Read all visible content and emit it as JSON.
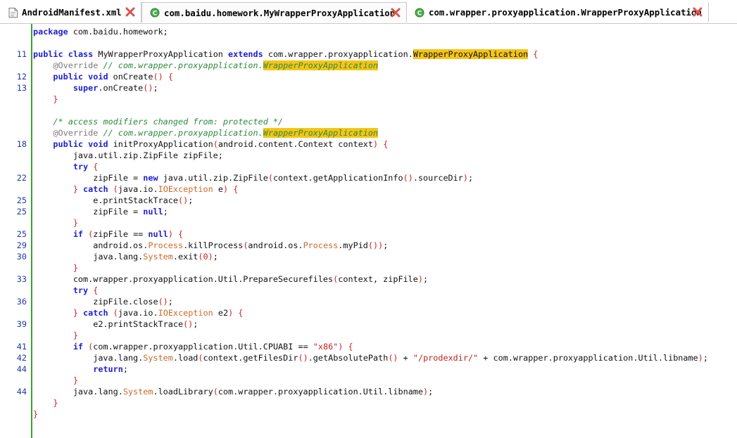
{
  "tabs": [
    {
      "label": "AndroidManifest.xml",
      "icon": "xml-file-icon",
      "active": false
    },
    {
      "label": "com.baidu.homework.MyWrapperProxyApplication",
      "icon": "java-class-icon",
      "active": true
    },
    {
      "label": "com.wrapper.proxyapplication.WrapperProxyApplication",
      "icon": "java-class-icon",
      "active": false
    }
  ],
  "colors": {
    "keyword": "#1f1fd0",
    "comment": "#2d8a3d",
    "annotation": "#7a7a7a",
    "highlight": "#f5c518",
    "class_ref": "#c86a2a",
    "bracket": "#d32020",
    "line_number": "#1d3a9e",
    "close_icon": "#d9534f"
  },
  "code_lines": [
    {
      "ln": "",
      "tokens": [
        [
          "kw",
          "package"
        ],
        [
          "p",
          " com.baidu.homework;"
        ]
      ]
    },
    {
      "ln": "",
      "tokens": []
    },
    {
      "ln": "11",
      "tokens": [
        [
          "kw",
          "public"
        ],
        [
          "p",
          " "
        ],
        [
          "kw",
          "class"
        ],
        [
          "p",
          " MyWrapperProxyApplication "
        ],
        [
          "kw",
          "extends"
        ],
        [
          "p",
          " com.wrapper.proxyapplication."
        ],
        [
          "hl",
          "WrapperProxyApplication"
        ],
        [
          "p",
          " "
        ],
        [
          "br",
          "{"
        ]
      ]
    },
    {
      "ln": "",
      "tokens": [
        [
          "p",
          "    "
        ],
        [
          "an",
          "@Override"
        ],
        [
          "cm",
          " // com.wrapper.proxyapplication."
        ],
        [
          "cmhl",
          "WrapperProxyApplication"
        ]
      ]
    },
    {
      "ln": "12",
      "tokens": [
        [
          "p",
          "    "
        ],
        [
          "kw",
          "public"
        ],
        [
          "p",
          " "
        ],
        [
          "kw",
          "void"
        ],
        [
          "p",
          " onCreate"
        ],
        [
          "br",
          "()"
        ],
        [
          "p",
          " "
        ],
        [
          "br",
          "{"
        ]
      ]
    },
    {
      "ln": "13",
      "tokens": [
        [
          "p",
          "        "
        ],
        [
          "kw",
          "super"
        ],
        [
          "p",
          ".onCreate"
        ],
        [
          "br",
          "()"
        ],
        [
          "p",
          ";"
        ]
      ]
    },
    {
      "ln": "",
      "tokens": [
        [
          "p",
          "    "
        ],
        [
          "br",
          "}"
        ]
      ]
    },
    {
      "ln": "",
      "tokens": []
    },
    {
      "ln": "",
      "tokens": [
        [
          "p",
          "    "
        ],
        [
          "cm",
          "/* access modifiers changed from: protected */"
        ]
      ]
    },
    {
      "ln": "",
      "tokens": [
        [
          "p",
          "    "
        ],
        [
          "an",
          "@Override"
        ],
        [
          "cm",
          " // com.wrapper.proxyapplication."
        ],
        [
          "cmhl",
          "WrapperProxyApplication"
        ]
      ]
    },
    {
      "ln": "18",
      "tokens": [
        [
          "p",
          "    "
        ],
        [
          "kw",
          "public"
        ],
        [
          "p",
          " "
        ],
        [
          "kw",
          "void"
        ],
        [
          "p",
          " initProxyApplication"
        ],
        [
          "br",
          "("
        ],
        [
          "p",
          "android.content.Context context"
        ],
        [
          "br",
          ")"
        ],
        [
          "p",
          " "
        ],
        [
          "br",
          "{"
        ]
      ]
    },
    {
      "ln": "",
      "tokens": [
        [
          "p",
          "        java.util.zip.ZipFile zipFile;"
        ]
      ]
    },
    {
      "ln": "",
      "tokens": [
        [
          "p",
          "        "
        ],
        [
          "kw",
          "try"
        ],
        [
          "p",
          " "
        ],
        [
          "br",
          "{"
        ]
      ]
    },
    {
      "ln": "22",
      "tokens": [
        [
          "p",
          "            zipFile = "
        ],
        [
          "kw",
          "new"
        ],
        [
          "p",
          " java.util.zip.ZipFile"
        ],
        [
          "br",
          "("
        ],
        [
          "p",
          "context.getApplicationInfo"
        ],
        [
          "br",
          "()"
        ],
        [
          "p",
          ".sourceDir"
        ],
        [
          "br",
          ")"
        ],
        [
          "p",
          ";"
        ]
      ]
    },
    {
      "ln": "",
      "tokens": [
        [
          "p",
          "        "
        ],
        [
          "br",
          "}"
        ],
        [
          "p",
          " "
        ],
        [
          "kw",
          "catch"
        ],
        [
          "p",
          " "
        ],
        [
          "br",
          "("
        ],
        [
          "p",
          "java.io."
        ],
        [
          "cls",
          "IOException"
        ],
        [
          "p",
          " e"
        ],
        [
          "br",
          ")"
        ],
        [
          "p",
          " "
        ],
        [
          "br",
          "{"
        ]
      ]
    },
    {
      "ln": "25",
      "tokens": [
        [
          "p",
          "            e.printStackTrace"
        ],
        [
          "br",
          "()"
        ],
        [
          "p",
          ";"
        ]
      ]
    },
    {
      "ln": "25",
      "tokens": [
        [
          "p",
          "            zipFile = "
        ],
        [
          "kw",
          "null"
        ],
        [
          "p",
          ";"
        ]
      ]
    },
    {
      "ln": "",
      "tokens": [
        [
          "p",
          "        "
        ],
        [
          "br",
          "}"
        ]
      ]
    },
    {
      "ln": "25",
      "tokens": [
        [
          "p",
          "        "
        ],
        [
          "kw",
          "if"
        ],
        [
          "p",
          " "
        ],
        [
          "br",
          "("
        ],
        [
          "p",
          "zipFile == "
        ],
        [
          "kw",
          "null"
        ],
        [
          "br",
          ")"
        ],
        [
          "p",
          " "
        ],
        [
          "br",
          "{"
        ]
      ]
    },
    {
      "ln": "29",
      "tokens": [
        [
          "p",
          "            android.os."
        ],
        [
          "cls",
          "Process"
        ],
        [
          "p",
          ".killProcess"
        ],
        [
          "br",
          "("
        ],
        [
          "p",
          "android.os."
        ],
        [
          "cls",
          "Process"
        ],
        [
          "p",
          ".myPid"
        ],
        [
          "br",
          "())"
        ],
        [
          "p",
          ";"
        ]
      ]
    },
    {
      "ln": "30",
      "tokens": [
        [
          "p",
          "            java.lang."
        ],
        [
          "cls",
          "System"
        ],
        [
          "p",
          ".exit"
        ],
        [
          "br",
          "("
        ],
        [
          "nm",
          "0"
        ],
        [
          "br",
          ")"
        ],
        [
          "p",
          ";"
        ]
      ]
    },
    {
      "ln": "",
      "tokens": [
        [
          "p",
          "        "
        ],
        [
          "br",
          "}"
        ]
      ]
    },
    {
      "ln": "33",
      "tokens": [
        [
          "p",
          "        com.wrapper.proxyapplication.Util.PrepareSecurefiles"
        ],
        [
          "br",
          "("
        ],
        [
          "p",
          "context, zipFile"
        ],
        [
          "br",
          ")"
        ],
        [
          "p",
          ";"
        ]
      ]
    },
    {
      "ln": "",
      "tokens": [
        [
          "p",
          "        "
        ],
        [
          "kw",
          "try"
        ],
        [
          "p",
          " "
        ],
        [
          "br",
          "{"
        ]
      ]
    },
    {
      "ln": "36",
      "tokens": [
        [
          "p",
          "            zipFile.close"
        ],
        [
          "br",
          "()"
        ],
        [
          "p",
          ";"
        ]
      ]
    },
    {
      "ln": "",
      "tokens": [
        [
          "p",
          "        "
        ],
        [
          "br",
          "}"
        ],
        [
          "p",
          " "
        ],
        [
          "kw",
          "catch"
        ],
        [
          "p",
          " "
        ],
        [
          "br",
          "("
        ],
        [
          "p",
          "java.io."
        ],
        [
          "cls",
          "IOException"
        ],
        [
          "p",
          " e2"
        ],
        [
          "br",
          ")"
        ],
        [
          "p",
          " "
        ],
        [
          "br",
          "{"
        ]
      ]
    },
    {
      "ln": "39",
      "tokens": [
        [
          "p",
          "            e2.printStackTrace"
        ],
        [
          "br",
          "()"
        ],
        [
          "p",
          ";"
        ]
      ]
    },
    {
      "ln": "",
      "tokens": [
        [
          "p",
          "        "
        ],
        [
          "br",
          "}"
        ]
      ]
    },
    {
      "ln": "41",
      "tokens": [
        [
          "p",
          "        "
        ],
        [
          "kw",
          "if"
        ],
        [
          "p",
          " "
        ],
        [
          "br",
          "("
        ],
        [
          "p",
          "com.wrapper.proxyapplication.Util.CPUABI == "
        ],
        [
          "st",
          "\"x86\""
        ],
        [
          "br",
          ")"
        ],
        [
          "p",
          " "
        ],
        [
          "br",
          "{"
        ]
      ]
    },
    {
      "ln": "42",
      "tokens": [
        [
          "p",
          "            java.lang."
        ],
        [
          "cls",
          "System"
        ],
        [
          "p",
          ".load"
        ],
        [
          "br",
          "("
        ],
        [
          "p",
          "context.getFilesDir"
        ],
        [
          "br",
          "()"
        ],
        [
          "p",
          ".getAbsolutePath"
        ],
        [
          "br",
          "()"
        ],
        [
          "p",
          " + "
        ],
        [
          "st",
          "\"/prodexdir/\""
        ],
        [
          "p",
          " + com.wrapper.proxyapplication.Util.libname"
        ],
        [
          "br",
          ")"
        ],
        [
          "p",
          ";"
        ]
      ]
    },
    {
      "ln": "44",
      "tokens": [
        [
          "p",
          "            "
        ],
        [
          "kw",
          "return"
        ],
        [
          "p",
          ";"
        ]
      ]
    },
    {
      "ln": "",
      "tokens": [
        [
          "p",
          "        "
        ],
        [
          "br",
          "}"
        ]
      ]
    },
    {
      "ln": "44",
      "tokens": [
        [
          "p",
          "        java.lang."
        ],
        [
          "cls",
          "System"
        ],
        [
          "p",
          ".loadLibrary"
        ],
        [
          "br",
          "("
        ],
        [
          "p",
          "com.wrapper.proxyapplication.Util.libname"
        ],
        [
          "br",
          ")"
        ],
        [
          "p",
          ";"
        ]
      ]
    },
    {
      "ln": "",
      "tokens": [
        [
          "p",
          "    "
        ],
        [
          "br",
          "}"
        ]
      ]
    },
    {
      "ln": "",
      "tokens": [
        [
          "br",
          "}"
        ]
      ]
    }
  ]
}
